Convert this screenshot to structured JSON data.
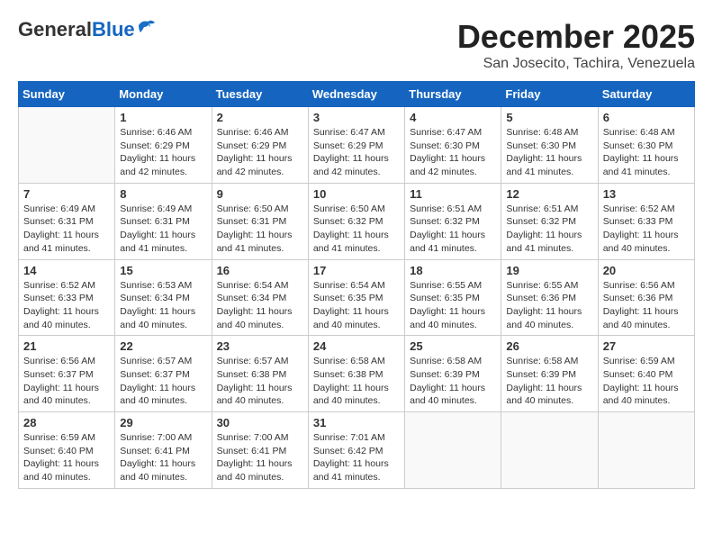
{
  "header": {
    "logo_general": "General",
    "logo_blue": "Blue",
    "main_title": "December 2025",
    "subtitle": "San Josecito, Tachira, Venezuela"
  },
  "days_of_week": [
    "Sunday",
    "Monday",
    "Tuesday",
    "Wednesday",
    "Thursday",
    "Friday",
    "Saturday"
  ],
  "weeks": [
    [
      {
        "day": "",
        "info": ""
      },
      {
        "day": "1",
        "info": "Sunrise: 6:46 AM\nSunset: 6:29 PM\nDaylight: 11 hours\nand 42 minutes."
      },
      {
        "day": "2",
        "info": "Sunrise: 6:46 AM\nSunset: 6:29 PM\nDaylight: 11 hours\nand 42 minutes."
      },
      {
        "day": "3",
        "info": "Sunrise: 6:47 AM\nSunset: 6:29 PM\nDaylight: 11 hours\nand 42 minutes."
      },
      {
        "day": "4",
        "info": "Sunrise: 6:47 AM\nSunset: 6:30 PM\nDaylight: 11 hours\nand 42 minutes."
      },
      {
        "day": "5",
        "info": "Sunrise: 6:48 AM\nSunset: 6:30 PM\nDaylight: 11 hours\nand 41 minutes."
      },
      {
        "day": "6",
        "info": "Sunrise: 6:48 AM\nSunset: 6:30 PM\nDaylight: 11 hours\nand 41 minutes."
      }
    ],
    [
      {
        "day": "7",
        "info": "Sunrise: 6:49 AM\nSunset: 6:31 PM\nDaylight: 11 hours\nand 41 minutes."
      },
      {
        "day": "8",
        "info": "Sunrise: 6:49 AM\nSunset: 6:31 PM\nDaylight: 11 hours\nand 41 minutes."
      },
      {
        "day": "9",
        "info": "Sunrise: 6:50 AM\nSunset: 6:31 PM\nDaylight: 11 hours\nand 41 minutes."
      },
      {
        "day": "10",
        "info": "Sunrise: 6:50 AM\nSunset: 6:32 PM\nDaylight: 11 hours\nand 41 minutes."
      },
      {
        "day": "11",
        "info": "Sunrise: 6:51 AM\nSunset: 6:32 PM\nDaylight: 11 hours\nand 41 minutes."
      },
      {
        "day": "12",
        "info": "Sunrise: 6:51 AM\nSunset: 6:32 PM\nDaylight: 11 hours\nand 41 minutes."
      },
      {
        "day": "13",
        "info": "Sunrise: 6:52 AM\nSunset: 6:33 PM\nDaylight: 11 hours\nand 40 minutes."
      }
    ],
    [
      {
        "day": "14",
        "info": "Sunrise: 6:52 AM\nSunset: 6:33 PM\nDaylight: 11 hours\nand 40 minutes."
      },
      {
        "day": "15",
        "info": "Sunrise: 6:53 AM\nSunset: 6:34 PM\nDaylight: 11 hours\nand 40 minutes."
      },
      {
        "day": "16",
        "info": "Sunrise: 6:54 AM\nSunset: 6:34 PM\nDaylight: 11 hours\nand 40 minutes."
      },
      {
        "day": "17",
        "info": "Sunrise: 6:54 AM\nSunset: 6:35 PM\nDaylight: 11 hours\nand 40 minutes."
      },
      {
        "day": "18",
        "info": "Sunrise: 6:55 AM\nSunset: 6:35 PM\nDaylight: 11 hours\nand 40 minutes."
      },
      {
        "day": "19",
        "info": "Sunrise: 6:55 AM\nSunset: 6:36 PM\nDaylight: 11 hours\nand 40 minutes."
      },
      {
        "day": "20",
        "info": "Sunrise: 6:56 AM\nSunset: 6:36 PM\nDaylight: 11 hours\nand 40 minutes."
      }
    ],
    [
      {
        "day": "21",
        "info": "Sunrise: 6:56 AM\nSunset: 6:37 PM\nDaylight: 11 hours\nand 40 minutes."
      },
      {
        "day": "22",
        "info": "Sunrise: 6:57 AM\nSunset: 6:37 PM\nDaylight: 11 hours\nand 40 minutes."
      },
      {
        "day": "23",
        "info": "Sunrise: 6:57 AM\nSunset: 6:38 PM\nDaylight: 11 hours\nand 40 minutes."
      },
      {
        "day": "24",
        "info": "Sunrise: 6:58 AM\nSunset: 6:38 PM\nDaylight: 11 hours\nand 40 minutes."
      },
      {
        "day": "25",
        "info": "Sunrise: 6:58 AM\nSunset: 6:39 PM\nDaylight: 11 hours\nand 40 minutes."
      },
      {
        "day": "26",
        "info": "Sunrise: 6:58 AM\nSunset: 6:39 PM\nDaylight: 11 hours\nand 40 minutes."
      },
      {
        "day": "27",
        "info": "Sunrise: 6:59 AM\nSunset: 6:40 PM\nDaylight: 11 hours\nand 40 minutes."
      }
    ],
    [
      {
        "day": "28",
        "info": "Sunrise: 6:59 AM\nSunset: 6:40 PM\nDaylight: 11 hours\nand 40 minutes."
      },
      {
        "day": "29",
        "info": "Sunrise: 7:00 AM\nSunset: 6:41 PM\nDaylight: 11 hours\nand 40 minutes."
      },
      {
        "day": "30",
        "info": "Sunrise: 7:00 AM\nSunset: 6:41 PM\nDaylight: 11 hours\nand 40 minutes."
      },
      {
        "day": "31",
        "info": "Sunrise: 7:01 AM\nSunset: 6:42 PM\nDaylight: 11 hours\nand 41 minutes."
      },
      {
        "day": "",
        "info": ""
      },
      {
        "day": "",
        "info": ""
      },
      {
        "day": "",
        "info": ""
      }
    ]
  ]
}
